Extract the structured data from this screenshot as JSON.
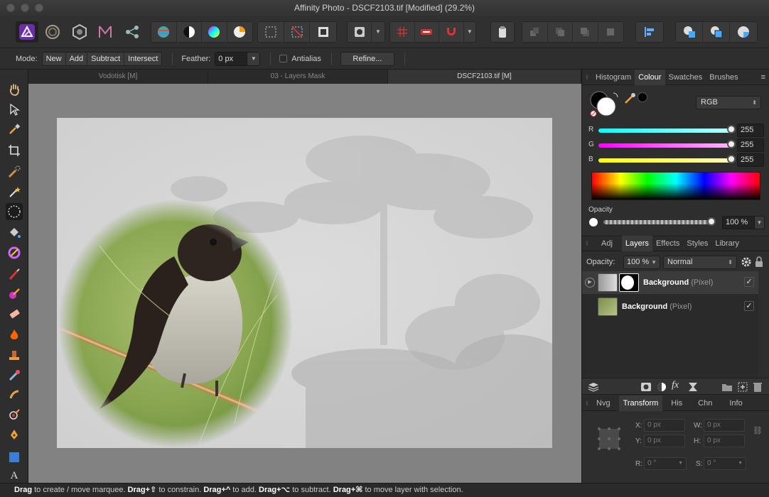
{
  "window": {
    "title": "Affinity Photo - DSCF2103.tif [Modified] (29.2%)"
  },
  "context_bar": {
    "mode_label": "Mode:",
    "mode_options": [
      "New",
      "Add",
      "Subtract",
      "Intersect"
    ],
    "feather_label": "Feather:",
    "feather_value": "0 px",
    "antialias_label": "Antialias",
    "refine_label": "Refine..."
  },
  "doc_tabs": [
    {
      "label": "Vodotisk [M]"
    },
    {
      "label": "03 - Layers Mask"
    },
    {
      "label": "DSCF2103.tif [M]"
    }
  ],
  "colour_panel": {
    "tabs": [
      "Histogram",
      "Colour",
      "Swatches",
      "Brushes"
    ],
    "active_tab": "Colour",
    "model": "RGB",
    "r_label": "R",
    "r_value": "255",
    "g_label": "G",
    "g_value": "255",
    "b_label": "B",
    "b_value": "255",
    "opacity_label": "Opacity",
    "opacity_value": "100 %"
  },
  "layers_panel": {
    "tabs": [
      "Adj",
      "Layers",
      "Effects",
      "Styles",
      "Library"
    ],
    "active_tab": "Layers",
    "opacity_label": "Opacity:",
    "opacity_value": "100 %",
    "blend_mode": "Normal",
    "layers": [
      {
        "name": "Background",
        "type": "(Pixel)",
        "visible": true
      },
      {
        "name": "Background",
        "type": "(Pixel)",
        "visible": true
      }
    ]
  },
  "transform_panel": {
    "tabs": [
      "Nvg",
      "Transform",
      "His",
      "Chn",
      "Info"
    ],
    "active_tab": "Transform",
    "x_label": "X:",
    "x_value": "0 px",
    "y_label": "Y:",
    "y_value": "0 px",
    "w_label": "W:",
    "w_value": "0 px",
    "h_label": "H:",
    "h_value": "0 px",
    "r_label": "R:",
    "r_value": "0 °",
    "s_label": "S:",
    "s_value": "0 °"
  },
  "status_bar": {
    "parts": [
      {
        "bold": "Drag",
        "text": " to create / move marquee. "
      },
      {
        "bold": "Drag+⇧",
        "text": " to constrain. "
      },
      {
        "bold": "Drag+^",
        "text": " to add. "
      },
      {
        "bold": "Drag+⌥",
        "text": " to subtract. "
      },
      {
        "bold": "Drag+⌘",
        "text": " to move layer with selection."
      }
    ]
  },
  "colors": {
    "accent": "#5b2f8c",
    "canvas_bg": "#828282",
    "panel_bg": "#2e2e2e"
  }
}
